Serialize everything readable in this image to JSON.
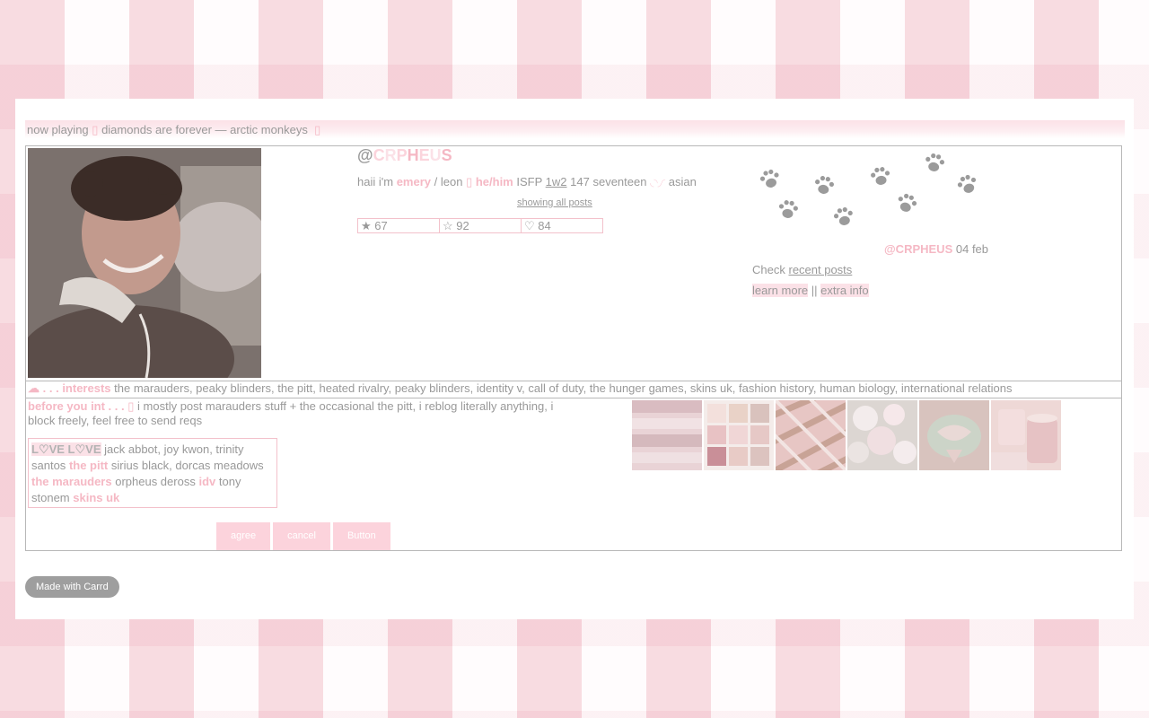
{
  "now_playing": {
    "prefix": "now playing",
    "glyph_left": "▯",
    "track": "diamonds are forever — arctic monkeys",
    "glyph_right": "▯"
  },
  "profile": {
    "at": "@",
    "handle_letters": [
      "C",
      "R",
      "P",
      "H",
      "E",
      "U",
      "S"
    ],
    "bio": {
      "t1": "haii i'm",
      "name": "emery",
      "t2": "/ leon",
      "glyph": "▯",
      "pronouns": "he/him",
      "t3": "ISFP",
      "type": "1w2",
      "t4": "147 seventeen",
      "kaomoji": "◟◝◞◜",
      "t5": "asian"
    },
    "show_all": "showing all posts",
    "stats": [
      {
        "icon": "★",
        "value": "67"
      },
      {
        "icon": "☆",
        "value": "92"
      },
      {
        "icon": "♡",
        "value": "84"
      }
    ]
  },
  "side": {
    "handle": "@CRPHEUS",
    "date": "04 feb",
    "check_prefix": "Check",
    "check_link": "recent posts",
    "learn_more": "learn more",
    "sep": "||",
    "extra_info": "extra info"
  },
  "interests": {
    "icon": "☁",
    "dots": ". . .",
    "label": "interests",
    "text": "the marauders, peaky blinders, the pitt, heated rivalry, peaky blinders, identity v, call of duty, the hunger games, skins uk, fashion history, human biology, international relations"
  },
  "before": {
    "label": "before you int . . .",
    "glyph": "▯",
    "text": "i mostly post marauders stuff + the occasional the pitt, i reblog literally anything, i block freely, feel free to send reqs"
  },
  "love": {
    "title": "L♡VE L♡VE",
    "t1": "jack abbot, joy kwon, trinity santos",
    "f1": "the pitt",
    "t2": "sirius black, dorcas meadows",
    "f2": "the marauders",
    "t3": "orpheus deross",
    "f3": "idv",
    "t4": "tony stonem",
    "f4": "skins uk"
  },
  "buttons": [
    "agree",
    "cancel",
    "Button"
  ],
  "footer": {
    "carrd": "Made with Carrd"
  },
  "colors": {
    "accent": "#f5b8c4",
    "gray": "#a9a9a9",
    "button": "#fcd3dc"
  }
}
